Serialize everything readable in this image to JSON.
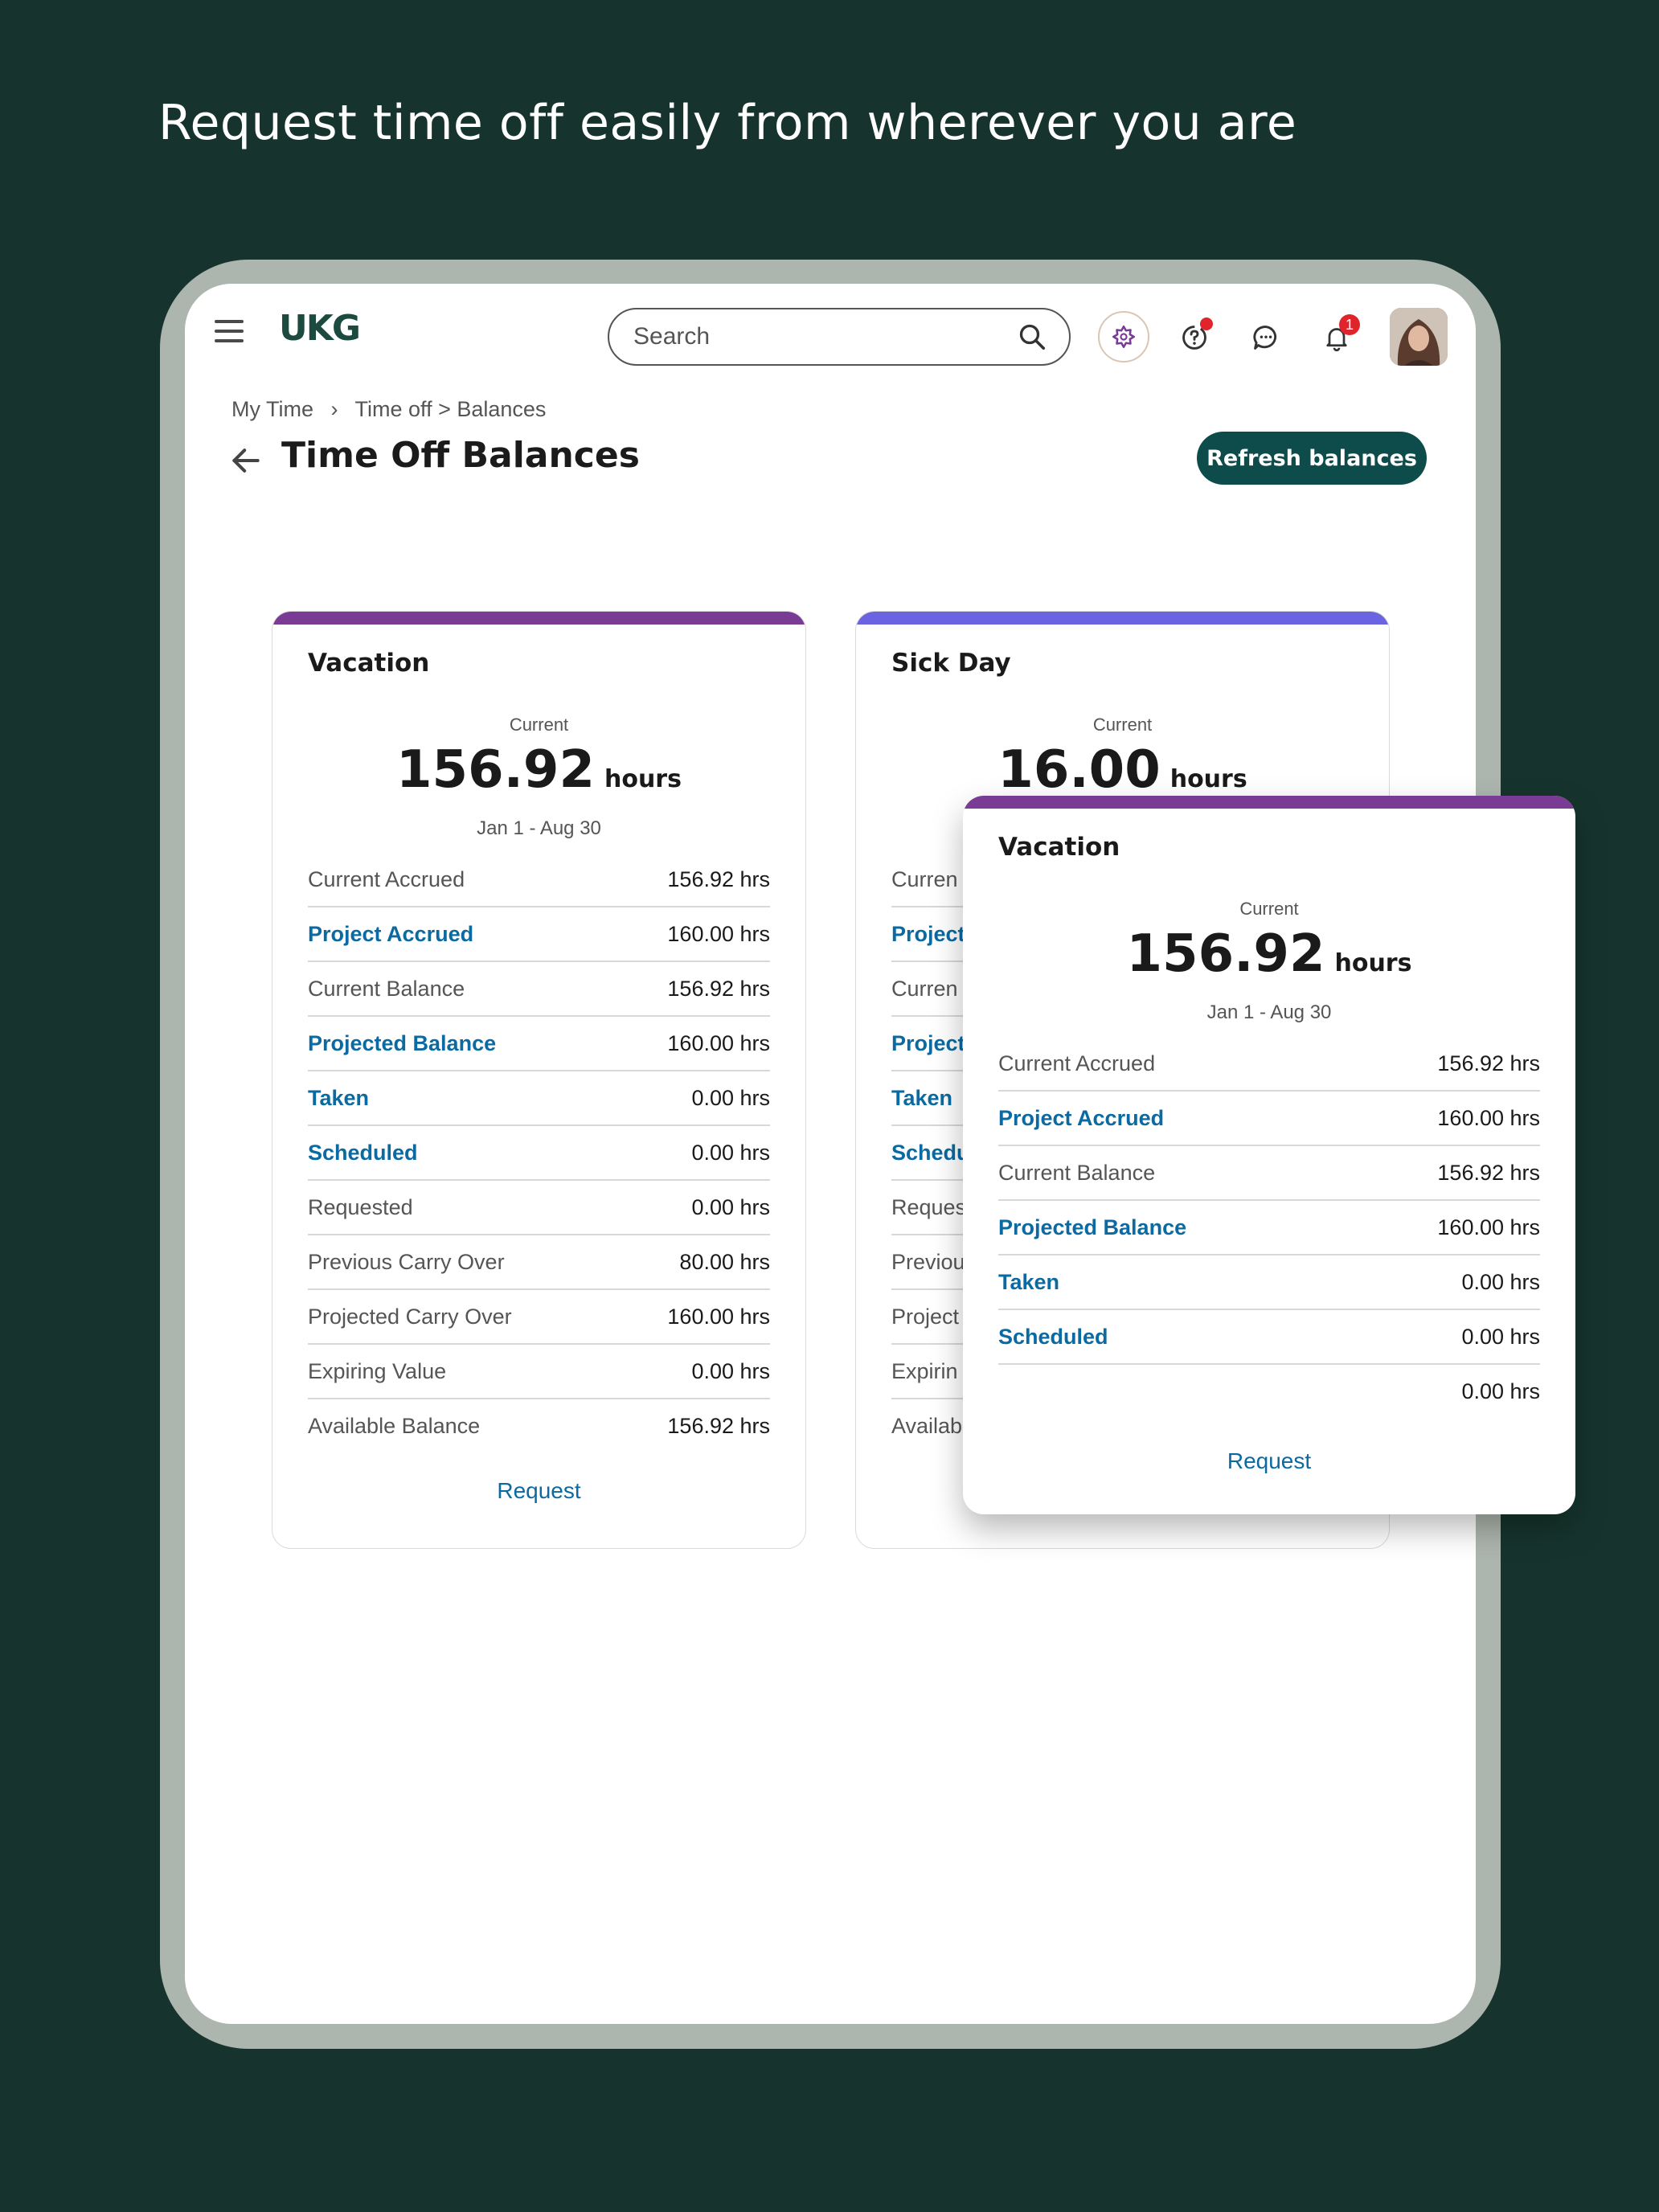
{
  "headline": "Request time off easily from wherever you are",
  "app": {
    "logo": "UKG",
    "search_placeholder": "Search",
    "notification_count": "1"
  },
  "breadcrumb": [
    "My Time",
    "Time off > Balances"
  ],
  "page_title": "Time Off Balances",
  "refresh_label": "Refresh balances",
  "colors": {
    "vacation": "#7a3b94",
    "sick": "#6b63e0",
    "primary_button": "#0e4c4c",
    "link": "#0a6aa1"
  },
  "cards": [
    {
      "title": "Vacation",
      "label": "Current",
      "value": "156.92",
      "unit": "hours",
      "range": "Jan 1 - Aug 30",
      "request_label": "Request",
      "rows": [
        {
          "label": "Current Accrued",
          "value": "156.92 hrs",
          "link": false
        },
        {
          "label": "Project Accrued",
          "value": "160.00 hrs",
          "link": true
        },
        {
          "label": "Current Balance",
          "value": "156.92 hrs",
          "link": false
        },
        {
          "label": "Projected Balance",
          "value": "160.00 hrs",
          "link": true
        },
        {
          "label": "Taken",
          "value": "0.00 hrs",
          "link": true
        },
        {
          "label": "Scheduled",
          "value": "0.00 hrs",
          "link": true
        },
        {
          "label": "Requested",
          "value": "0.00 hrs",
          "link": false
        },
        {
          "label": "Previous Carry Over",
          "value": "80.00 hrs",
          "link": false
        },
        {
          "label": "Projected Carry Over",
          "value": "160.00 hrs",
          "link": false
        },
        {
          "label": "Expiring Value",
          "value": "0.00 hrs",
          "link": false
        },
        {
          "label": "Available Balance",
          "value": "156.92 hrs",
          "link": false
        }
      ]
    },
    {
      "title": "Sick Day",
      "label": "Current",
      "value": "16.00",
      "unit": "hours",
      "range": "",
      "request_label": "",
      "rows": [
        {
          "label": "Curren",
          "value": "",
          "link": false
        },
        {
          "label": "Project",
          "value": "",
          "link": true
        },
        {
          "label": "Curren",
          "value": "",
          "link": false
        },
        {
          "label": "Project",
          "value": "",
          "link": true
        },
        {
          "label": "Taken",
          "value": "",
          "link": true
        },
        {
          "label": "Schedu",
          "value": "",
          "link": true
        },
        {
          "label": "Reques",
          "value": "",
          "link": false
        },
        {
          "label": "Previou",
          "value": "",
          "link": false
        },
        {
          "label": "Project",
          "value": "",
          "link": false
        },
        {
          "label": "Expirin",
          "value": "",
          "link": false
        },
        {
          "label": "Availab",
          "value": "",
          "link": false
        }
      ]
    }
  ],
  "overlay_card": {
    "title": "Vacation",
    "label": "Current",
    "value": "156.92",
    "unit": "hours",
    "range": "Jan 1 - Aug 30",
    "request_label": "Request",
    "rows": [
      {
        "label": "Current Accrued",
        "value": "156.92 hrs",
        "link": false
      },
      {
        "label": "Project Accrued",
        "value": "160.00 hrs",
        "link": true
      },
      {
        "label": "Current Balance",
        "value": "156.92 hrs",
        "link": false
      },
      {
        "label": "Projected Balance",
        "value": "160.00 hrs",
        "link": true
      },
      {
        "label": "Taken",
        "value": "0.00 hrs",
        "link": true
      },
      {
        "label": "Scheduled",
        "value": "0.00 hrs",
        "link": true
      },
      {
        "label": "",
        "value": "0.00 hrs",
        "link": false
      }
    ]
  }
}
